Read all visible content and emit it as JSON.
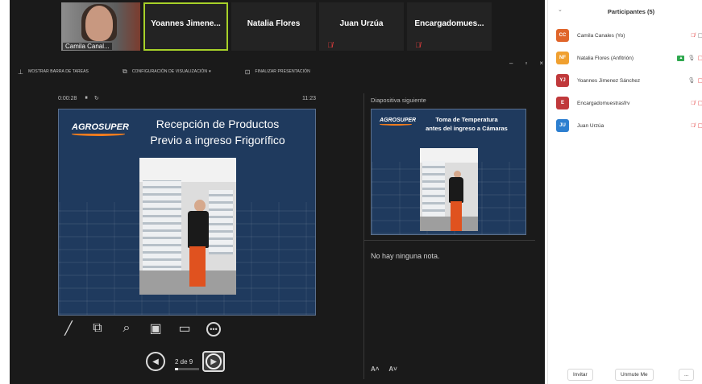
{
  "video_strip": {
    "tiles": [
      {
        "name": "Camila Canal..."
      },
      {
        "name": "Yoannes Jimene..."
      },
      {
        "name": "Natalia Flores"
      },
      {
        "name": "Juan Urzúa"
      },
      {
        "name": "Encargadomues..."
      }
    ]
  },
  "presenter_toolbar": {
    "show_taskbar": "MOSTRAR BARRA DE TAREAS",
    "display_settings": "CONFIGURACIÓN DE VISUALIZACIÓN",
    "end_presentation": "FINALIZAR PRESENTACIÓN"
  },
  "presenter": {
    "elapsed": "0:00:28",
    "clock": "11:23",
    "current_slide": {
      "logo": "AGROSUPER",
      "title_line1": "Recepción de Productos",
      "title_line2": "Previo a ingreso Frigorífico"
    },
    "next_label": "Diapositiva siguiente",
    "next_slide": {
      "logo": "AGROSUPER",
      "title_line1": "Toma de Temperatura",
      "title_line2": "antes del ingreso a Cámaras"
    },
    "notes": "No hay ninguna nota.",
    "page_label": "2 de 9"
  },
  "participants": {
    "title": "Participantes (5)",
    "items": [
      {
        "initials": "CC",
        "name": "Camila Canales (Yo)",
        "color": "#e0652a"
      },
      {
        "initials": "NF",
        "name": "Natalia Flores (Anfitrión)",
        "color": "#f0a030"
      },
      {
        "initials": "YJ",
        "name": "Yoannes Jimenez Sánchez",
        "color": "#c0393b"
      },
      {
        "initials": "E",
        "name": "Encargadomuestrasfrv",
        "color": "#c0393b"
      },
      {
        "initials": "JU",
        "name": "Juan Urzúa",
        "color": "#2d7fd0"
      }
    ],
    "invite_label": "Invitar",
    "unmute_label": "Unmute Me",
    "more_label": "..."
  }
}
